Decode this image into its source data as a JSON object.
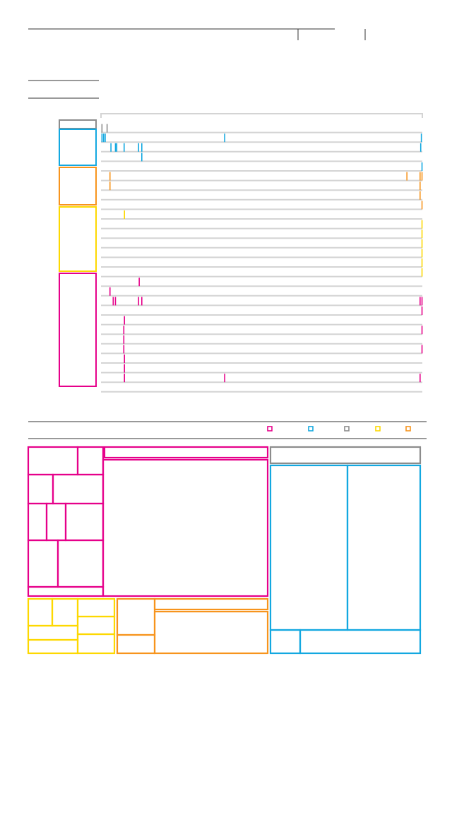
{
  "colors": {
    "magenta": "#e6008a",
    "cyan": "#13a8e0",
    "gray": "#8c8c8c",
    "yellow": "#fdd800",
    "orange": "#f7941d",
    "track": "#d4d4d4",
    "rule": "#333333"
  },
  "legend": [
    "magenta",
    "cyan",
    "gray",
    "yellow",
    "orange"
  ],
  "chart_data": [
    {
      "type": "timeline",
      "description_free": true,
      "groups": [
        {
          "color": "gray",
          "rows": 1
        },
        {
          "color": "cyan",
          "rows": 4
        },
        {
          "color": "orange",
          "rows": 4
        },
        {
          "color": "yellow",
          "rows": 7
        },
        {
          "color": "magenta",
          "rows": 12
        }
      ],
      "rows": [
        {
          "color": "gray",
          "events": [
            0.003,
            0.019
          ]
        },
        {
          "color": "cyan",
          "events": [
            0.003,
            0.008,
            0.013,
            0.385,
            0.997
          ]
        },
        {
          "color": "cyan",
          "events": [
            0.031,
            0.045,
            0.049,
            0.072,
            0.117,
            0.127,
            0.995
          ]
        },
        {
          "color": "cyan",
          "events": [
            0.127
          ]
        },
        {
          "color": "cyan",
          "events": [
            0.999
          ]
        },
        {
          "color": "orange",
          "events": [
            0.028,
            0.952,
            0.993,
            0.999
          ]
        },
        {
          "color": "orange",
          "events": [
            0.028,
            0.993
          ]
        },
        {
          "color": "orange",
          "events": [
            0.993
          ]
        },
        {
          "color": "orange",
          "events": [
            0.999
          ]
        },
        {
          "color": "yellow",
          "events": [
            0.073
          ]
        },
        {
          "color": "yellow",
          "events": [
            0.999
          ]
        },
        {
          "color": "yellow",
          "events": [
            0.999
          ]
        },
        {
          "color": "yellow",
          "events": [
            0.999
          ]
        },
        {
          "color": "yellow",
          "events": [
            0.999
          ]
        },
        {
          "color": "yellow",
          "events": [
            0.999
          ]
        },
        {
          "color": "yellow",
          "events": [
            0.999
          ]
        },
        {
          "color": "magenta",
          "events": [
            0.119
          ]
        },
        {
          "color": "magenta",
          "events": [
            0.028
          ]
        },
        {
          "color": "magenta",
          "events": [
            0.038,
            0.045,
            0.117,
            0.127,
            0.993,
            0.999
          ]
        },
        {
          "color": "magenta",
          "events": [
            0.999
          ]
        },
        {
          "color": "magenta",
          "events": [
            0.073
          ]
        },
        {
          "color": "magenta",
          "events": [
            0.071,
            0.999
          ]
        },
        {
          "color": "magenta",
          "events": [
            0.071
          ]
        },
        {
          "color": "magenta",
          "events": [
            0.071,
            0.999
          ]
        },
        {
          "color": "magenta",
          "events": [
            0.073
          ]
        },
        {
          "color": "magenta",
          "events": [
            0.073
          ]
        },
        {
          "color": "magenta",
          "events": [
            0.073,
            0.385,
            0.993
          ]
        },
        {
          "color": "magenta",
          "events": []
        }
      ]
    },
    {
      "type": "treemap",
      "groups": [
        {
          "color": "magenta",
          "cells": 13
        },
        {
          "color": "cyan",
          "cells": 4
        },
        {
          "color": "gray",
          "cells": 1
        },
        {
          "color": "yellow",
          "cells": 8
        },
        {
          "color": "orange",
          "cells": 4
        }
      ]
    }
  ]
}
